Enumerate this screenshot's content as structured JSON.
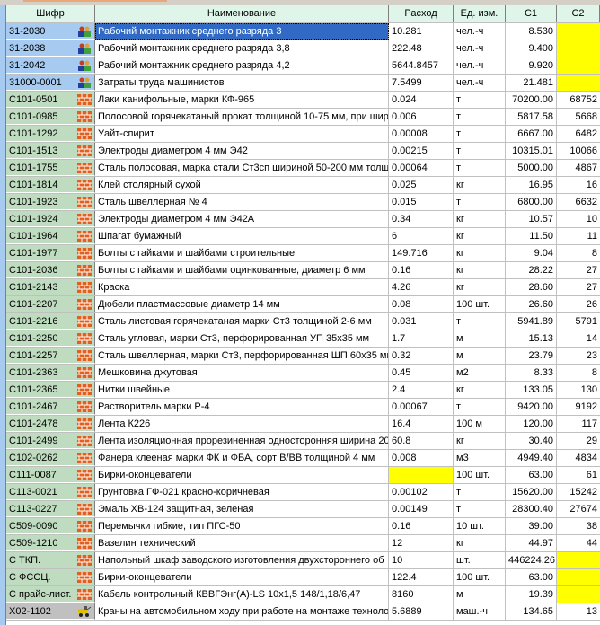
{
  "columns": [
    "Шифр",
    "Наименование",
    "Расход",
    "Ед. изм.",
    "С1",
    "С2"
  ],
  "colors": {
    "labor": "#a6caf0",
    "material": "#c0dcc0",
    "machine": "#c0c0c0",
    "header": "#dff5ea",
    "highlight": "#ffff00",
    "selected": "#316ac5"
  },
  "rows": [
    {
      "code": "31-2030",
      "type": "labor",
      "icon": "workers-icon",
      "name": "Рабочий монтажник среднего разряда 3",
      "qty": "10.281",
      "unit": "чел.-ч",
      "c1": "8.530",
      "c2": "",
      "c2_yellow": true,
      "selected": true
    },
    {
      "code": "31-2038",
      "type": "labor",
      "icon": "workers-icon",
      "name": "Рабочий монтажник среднего разряда 3,8",
      "qty": "222.48",
      "unit": "чел.-ч",
      "c1": "9.400",
      "c2": "",
      "c2_yellow": true
    },
    {
      "code": "31-2042",
      "type": "labor",
      "icon": "workers-icon",
      "name": "Рабочий монтажник среднего разряда 4,2",
      "qty": "5644.8457",
      "unit": "чел.-ч",
      "c1": "9.920",
      "c2": "",
      "c2_yellow": true
    },
    {
      "code": "31000-0001",
      "type": "labor",
      "icon": "workers-icon",
      "name": "Затраты труда машинистов",
      "qty": "7.5499",
      "unit": "чел.-ч",
      "c1": "21.481",
      "c2": "",
      "c2_yellow": true
    },
    {
      "code": "С101-0501",
      "type": "mat",
      "icon": "bricks-icon",
      "name": "Лаки канифольные, марки КФ-965",
      "qty": "0.024",
      "unit": "т",
      "c1": "70200.00",
      "c2": "68752"
    },
    {
      "code": "С101-0985",
      "type": "mat",
      "icon": "bricks-icon",
      "name": "Полосовой горячекатаный прокат толщиной 10-75 мм, при шир",
      "qty": "0.006",
      "unit": "т",
      "c1": "5817.58",
      "c2": "5668"
    },
    {
      "code": "С101-1292",
      "type": "mat",
      "icon": "bricks-icon",
      "name": "Уайт-спирит",
      "qty": "0.00008",
      "unit": "т",
      "c1": "6667.00",
      "c2": "6482"
    },
    {
      "code": "С101-1513",
      "type": "mat",
      "icon": "bricks-icon",
      "name": "Электроды диаметром 4 мм Э42",
      "qty": "0.00215",
      "unit": "т",
      "c1": "10315.01",
      "c2": "10066"
    },
    {
      "code": "С101-1755",
      "type": "mat",
      "icon": "bricks-icon",
      "name": "Сталь полосовая, марка стали Ст3сп шириной 50-200 мм толщ",
      "qty": "0.00064",
      "unit": "т",
      "c1": "5000.00",
      "c2": "4867"
    },
    {
      "code": "С101-1814",
      "type": "mat",
      "icon": "bricks-icon",
      "name": "Клей столярный сухой",
      "qty": "0.025",
      "unit": "кг",
      "c1": "16.95",
      "c2": "16"
    },
    {
      "code": "С101-1923",
      "type": "mat",
      "icon": "bricks-icon",
      "name": "Сталь швеллерная № 4",
      "qty": "0.015",
      "unit": "т",
      "c1": "6800.00",
      "c2": "6632"
    },
    {
      "code": "С101-1924",
      "type": "mat",
      "icon": "bricks-icon",
      "name": "Электроды диаметром 4 мм Э42А",
      "qty": "0.34",
      "unit": "кг",
      "c1": "10.57",
      "c2": "10"
    },
    {
      "code": "С101-1964",
      "type": "mat",
      "icon": "bricks-icon",
      "name": "Шпагат бумажный",
      "qty": "6",
      "unit": "кг",
      "c1": "11.50",
      "c2": "11"
    },
    {
      "code": "С101-1977",
      "type": "mat",
      "icon": "bricks-icon",
      "name": "Болты с гайками и шайбами строительные",
      "qty": "149.716",
      "unit": "кг",
      "c1": "9.04",
      "c2": "8"
    },
    {
      "code": "С101-2036",
      "type": "mat",
      "icon": "bricks-icon",
      "name": "Болты с гайками и шайбами оцинкованные, диаметр 6 мм",
      "qty": "0.16",
      "unit": "кг",
      "c1": "28.22",
      "c2": "27"
    },
    {
      "code": "С101-2143",
      "type": "mat",
      "icon": "bricks-icon",
      "name": "Краска",
      "qty": "4.26",
      "unit": "кг",
      "c1": "28.60",
      "c2": "27"
    },
    {
      "code": "С101-2207",
      "type": "mat",
      "icon": "bricks-icon",
      "name": "Дюбели пластмассовые диаметр 14 мм",
      "qty": "0.08",
      "unit": "100 шт.",
      "c1": "26.60",
      "c2": "26"
    },
    {
      "code": "С101-2216",
      "type": "mat",
      "icon": "bricks-icon",
      "name": "Сталь листовая горячекатаная марки Ст3 толщиной 2-6 мм",
      "qty": "0.031",
      "unit": "т",
      "c1": "5941.89",
      "c2": "5791"
    },
    {
      "code": "С101-2250",
      "type": "mat",
      "icon": "bricks-icon",
      "name": "Сталь угловая, марки Ст3, перфорированная УП 35х35 мм",
      "qty": "1.7",
      "unit": "м",
      "c1": "15.13",
      "c2": "14"
    },
    {
      "code": "С101-2257",
      "type": "mat",
      "icon": "bricks-icon",
      "name": "Сталь швеллерная, марки Ст3, перфорированная ШП 60х35 мм",
      "qty": "0.32",
      "unit": "м",
      "c1": "23.79",
      "c2": "23"
    },
    {
      "code": "С101-2363",
      "type": "mat",
      "icon": "bricks-icon",
      "name": "Мешковина джутовая",
      "qty": "0.45",
      "unit": "м2",
      "c1": "8.33",
      "c2": "8"
    },
    {
      "code": "С101-2365",
      "type": "mat",
      "icon": "bricks-icon",
      "name": "Нитки швейные",
      "qty": "2.4",
      "unit": "кг",
      "c1": "133.05",
      "c2": "130"
    },
    {
      "code": "С101-2467",
      "type": "mat",
      "icon": "bricks-icon",
      "name": "Растворитель марки Р-4",
      "qty": "0.00067",
      "unit": "т",
      "c1": "9420.00",
      "c2": "9192"
    },
    {
      "code": "С101-2478",
      "type": "mat",
      "icon": "bricks-icon",
      "name": "Лента К226",
      "qty": "16.4",
      "unit": "100 м",
      "c1": "120.00",
      "c2": "117"
    },
    {
      "code": "С101-2499",
      "type": "mat",
      "icon": "bricks-icon",
      "name": "Лента изоляционная прорезиненная односторонняя ширина 20",
      "qty": "60.8",
      "unit": "кг",
      "c1": "30.40",
      "c2": "29"
    },
    {
      "code": "С102-0262",
      "type": "mat",
      "icon": "bricks-icon",
      "name": "Фанера клееная марки ФК и ФБА, сорт В/ВВ толщиной 4 мм",
      "qty": "0.008",
      "unit": "м3",
      "c1": "4949.40",
      "c2": "4834"
    },
    {
      "code": "С111-0087",
      "type": "mat",
      "icon": "bricks-icon",
      "name": "Бирки-оконцеватели",
      "qty": "",
      "qty_yellow": true,
      "unit": "100 шт.",
      "c1": "63.00",
      "c2": "61"
    },
    {
      "code": "С113-0021",
      "type": "mat",
      "icon": "bricks-icon",
      "name": "Грунтовка ГФ-021 красно-коричневая",
      "qty": "0.00102",
      "unit": "т",
      "c1": "15620.00",
      "c2": "15242"
    },
    {
      "code": "С113-0227",
      "type": "mat",
      "icon": "bricks-icon",
      "name": "Эмаль ХВ-124 защитная, зеленая",
      "qty": "0.00149",
      "unit": "т",
      "c1": "28300.40",
      "c2": "27674"
    },
    {
      "code": "С509-0090",
      "type": "mat",
      "icon": "bricks-icon",
      "name": "Перемычки гибкие, тип ПГС-50",
      "qty": "0.16",
      "unit": "10 шт.",
      "c1": "39.00",
      "c2": "38"
    },
    {
      "code": "С509-1210",
      "type": "mat",
      "icon": "bricks-icon",
      "name": "Вазелин технический",
      "qty": "12",
      "unit": "кг",
      "c1": "44.97",
      "c2": "44"
    },
    {
      "code": "С ТКП.",
      "type": "mat",
      "icon": "bricks-icon",
      "name": "Напольный шкаф заводского изготовления двухстороннего об",
      "qty": "10",
      "unit": "шт.",
      "c1": "446224.26",
      "c2": "",
      "c2_yellow": true
    },
    {
      "code": "С ФССЦ.",
      "type": "mat",
      "icon": "bricks-icon",
      "name": "Бирки-оконцеватели",
      "qty": "122.4",
      "unit": "100 шт.",
      "c1": "63.00",
      "c2": "",
      "c2_yellow": true
    },
    {
      "code": "С прайс-лист.",
      "type": "mat",
      "icon": "bricks-icon",
      "name": "Кабель контрольный КВВГЭнг(А)-LS 10х1,5      148/1,18/6,47",
      "qty": "8160",
      "unit": "м",
      "c1": "19.39",
      "c2": "",
      "c2_yellow": true
    },
    {
      "code": "Х02-1102",
      "type": "mach",
      "icon": "machine-icon",
      "name": "Краны на автомобильном ходу при работе на монтаже технолог",
      "qty": "5.6889",
      "unit": "маш.-ч",
      "c1": "134.65",
      "c2": "13"
    }
  ]
}
